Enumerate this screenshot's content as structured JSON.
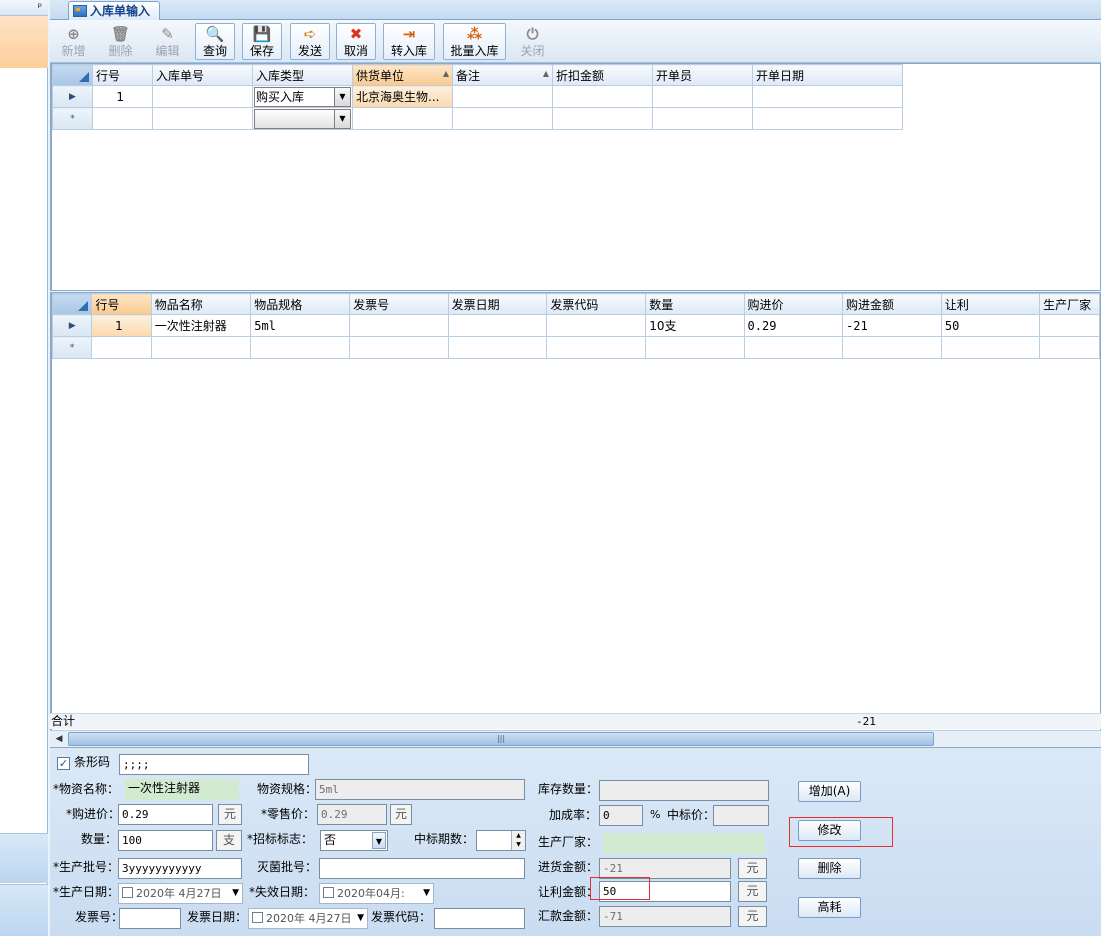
{
  "left_panel": {
    "pin_glyph": "ᵖ"
  },
  "tab": {
    "title": "入库单输入"
  },
  "toolbar": [
    {
      "label": "新增",
      "glyph": "⊕",
      "color": "#8a8a8a",
      "enabled": false
    },
    {
      "label": "删除",
      "glyph": "🗑",
      "color": "#8a8a8a",
      "enabled": false
    },
    {
      "label": "编辑",
      "glyph": "✎",
      "color": "#8a8a8a",
      "enabled": false
    },
    {
      "label": "查询",
      "glyph": "🔍",
      "color": "#d07a10",
      "enabled": true
    },
    {
      "label": "保存",
      "glyph": "💾",
      "color": "#d03030",
      "enabled": true
    },
    {
      "label": "发送",
      "glyph": "➪",
      "color": "#d07a10",
      "enabled": true
    },
    {
      "label": "取消",
      "glyph": "✖",
      "color": "#e0301e",
      "enabled": true
    },
    {
      "label": "转入库",
      "glyph": "⇥",
      "color": "#d86010",
      "enabled": true
    },
    {
      "label": "批量入库",
      "glyph": "⁂",
      "color": "#d86010",
      "enabled": true
    },
    {
      "label": "关闭",
      "glyph": "⏻",
      "color": "#8a8a8a",
      "enabled": false
    }
  ],
  "grid1": {
    "columns": [
      "行号",
      "入库单号",
      "入库类型",
      "供货单位",
      "备注",
      "折扣金额",
      "开单员",
      "开单日期"
    ],
    "row": {
      "row_no": "1",
      "order_no": "",
      "type": "购买入库",
      "supplier": "北京海奥生物...",
      "remark": "",
      "discount": "",
      "operator": "",
      "date": ""
    },
    "new_row_marker": "*",
    "current_row_marker": "▶"
  },
  "grid2": {
    "columns": [
      "行号",
      "物品名称",
      "物品规格",
      "发票号",
      "发票日期",
      "发票代码",
      "数量",
      "购进价",
      "购进金额",
      "让利",
      "生产厂家"
    ],
    "row": {
      "row_no": "1",
      "name": "一次性注射器",
      "spec": "5ml",
      "invoice_no": "",
      "invoice_date": "",
      "invoice_code": "",
      "qty": "10支",
      "price": "0.29",
      "amount": "-21",
      "rebate": "50",
      "manufacturer": ""
    },
    "new_row_marker": "*",
    "current_row_marker": "▶",
    "sum_label": "合计",
    "sum_value": "-21"
  },
  "form": {
    "barcode": {
      "label": "条形码",
      "value": ";;;;",
      "checked": true
    },
    "material_name": {
      "label": "*物资名称：",
      "value": "一次性注射器"
    },
    "material_spec": {
      "label": "物资规格：",
      "value": "5ml"
    },
    "stock_qty": {
      "label": "库存数量：",
      "value": ""
    },
    "purchase_price": {
      "label": "*购进价：",
      "value": "0.29",
      "unit": "元"
    },
    "retail_price": {
      "label": "*零售价：",
      "value": "0.29",
      "unit": "元"
    },
    "markup_rate": {
      "label": "加成率：",
      "value": "0",
      "unit": "%"
    },
    "bid_price": {
      "label": "中标价：",
      "value": ""
    },
    "quantity": {
      "label": "数量：",
      "value": "100",
      "unit": "支"
    },
    "bid_flag": {
      "label": "*招标标志：",
      "value": "否"
    },
    "bid_periods": {
      "label": "中标期数：",
      "value": ""
    },
    "manufacturer": {
      "label": "生产厂家：",
      "value": ""
    },
    "batch_no": {
      "label": "*生产批号：",
      "value": "3yyyyyyyyyyy"
    },
    "sterile_batch": {
      "label": "灭菌批号：",
      "value": ""
    },
    "purchase_amount": {
      "label": "进货金额：",
      "value": "-21",
      "unit": "元"
    },
    "production_date": {
      "label": "*生产日期：",
      "value": "2020年 4月27日"
    },
    "expiry_date": {
      "label": "*失效日期：",
      "value": "2020年04月:"
    },
    "rebate_amount": {
      "label": "让利金额：",
      "value": "50",
      "unit": "元"
    },
    "invoice_no": {
      "label": "发票号：",
      "value": ""
    },
    "invoice_date": {
      "label": "发票日期：",
      "value": "2020年 4月27日"
    },
    "invoice_code": {
      "label": "发票代码：",
      "value": ""
    },
    "remit_amount": {
      "label": "汇款金额：",
      "value": "-71",
      "unit": "元"
    },
    "buttons": {
      "add": "增加(A)",
      "modify": "修改",
      "delete": "删除",
      "high": "高耗"
    }
  },
  "colors": {
    "highlight_box": "#e03030",
    "selection": "#fbd9ad",
    "accent": "#15428b"
  }
}
